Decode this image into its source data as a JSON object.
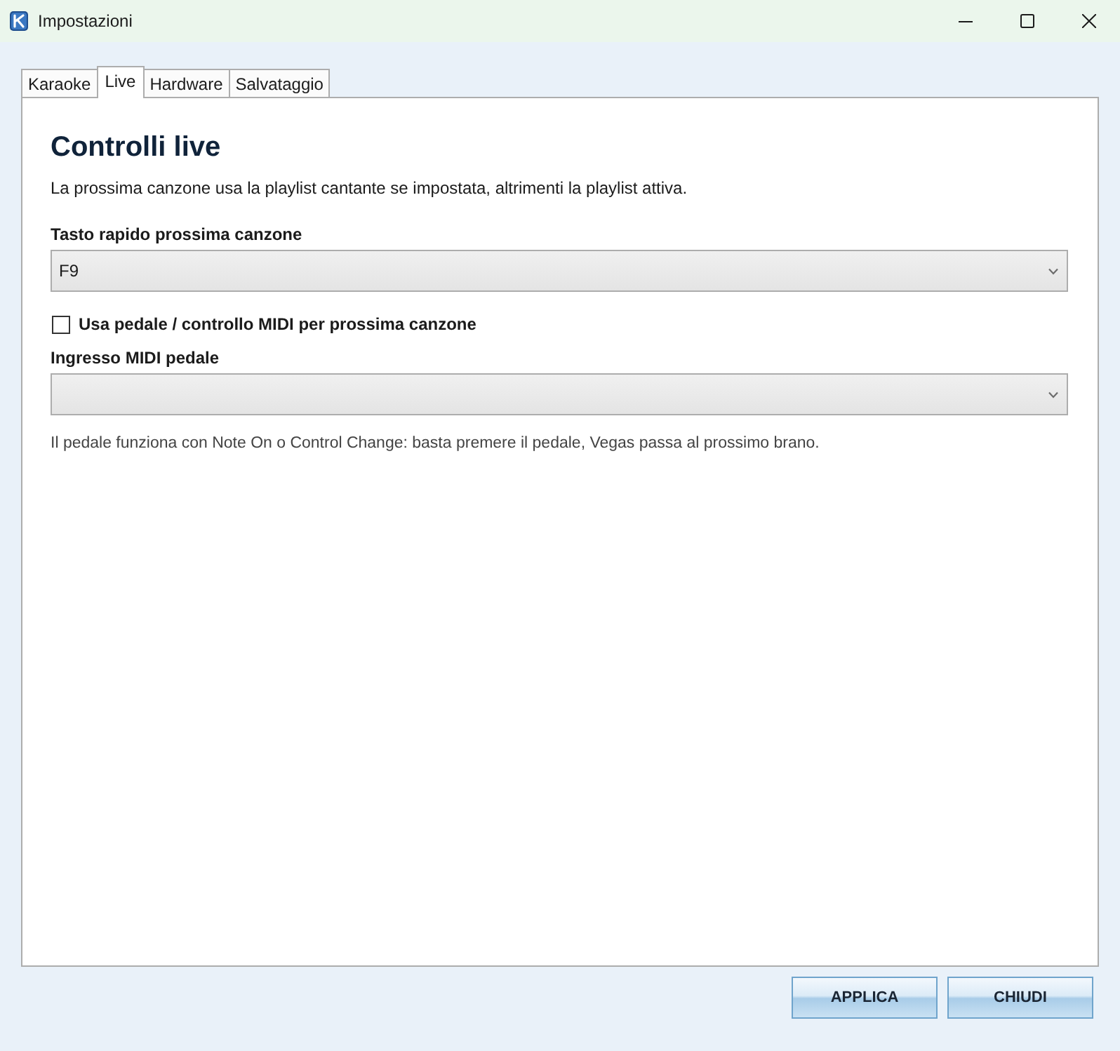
{
  "window": {
    "title": "Impostazioni"
  },
  "tabs": [
    {
      "label": "Karaoke",
      "selected": false
    },
    {
      "label": "Live",
      "selected": true
    },
    {
      "label": "Hardware",
      "selected": false
    },
    {
      "label": "Salvataggio",
      "selected": false
    }
  ],
  "panel": {
    "heading": "Controlli live",
    "description": "La prossima canzone usa la playlist cantante se impostata, altrimenti la playlist attiva.",
    "fields": [
      {
        "kind": "dropdown",
        "label": "Tasto rapido prossima canzone",
        "value": "F9"
      },
      {
        "kind": "checkbox",
        "label": "Usa pedale / controllo MIDI per prossima canzone",
        "checked": false
      },
      {
        "kind": "dropdown",
        "label": "Ingresso MIDI pedale"
      }
    ],
    "note": "Il pedale funziona con Note On o Control Change: basta premere il pedale, Vegas passa al prossimo brano."
  },
  "buttons": [
    "APPLICA",
    "CHIUDI"
  ]
}
